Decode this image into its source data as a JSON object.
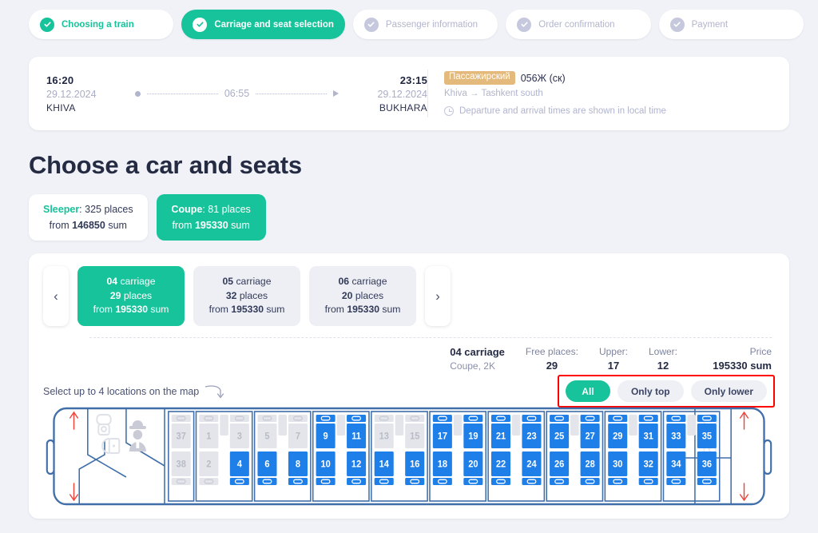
{
  "stepper": {
    "steps": [
      {
        "label": "Choosing a train",
        "state": "done"
      },
      {
        "label": "Carriage and seat selection",
        "state": "active"
      },
      {
        "label": "Passenger information",
        "state": "todo"
      },
      {
        "label": "Order confirmation",
        "state": "todo"
      },
      {
        "label": "Payment",
        "state": "todo"
      }
    ]
  },
  "train_card": {
    "departure": {
      "time": "16:20",
      "date": "29.12.2024",
      "city": "KHIVA"
    },
    "arrival": {
      "time": "23:15",
      "date": "29.12.2024",
      "city": "BUKHARA"
    },
    "duration": "06:55",
    "type_badge": "Пассажирский",
    "train_number": "056Ж (ск)",
    "full_route": "Khiva → Tashkent south",
    "local_time_note": "Departure and arrival times are shown in local time"
  },
  "page_title": "Choose a car and seats",
  "class_tabs": [
    {
      "name": "Sleeper",
      "places": "325 places",
      "from": "from",
      "price": "146850",
      "currency": "sum",
      "selected": false
    },
    {
      "name": "Coupe",
      "places": "81 places",
      "from": "from",
      "price": "195330",
      "currency": "sum",
      "selected": true
    }
  ],
  "carriages": {
    "prev_label": "‹",
    "next_label": "›",
    "items": [
      {
        "number": "04",
        "word": "carriage",
        "places": "29",
        "places_word": "places",
        "from": "from",
        "price": "195330",
        "currency": "sum",
        "selected": true
      },
      {
        "number": "05",
        "word": "carriage",
        "places": "32",
        "places_word": "places",
        "from": "from",
        "price": "195330",
        "currency": "sum",
        "selected": false
      },
      {
        "number": "06",
        "word": "carriage",
        "places": "20",
        "places_word": "places",
        "from": "from",
        "price": "195330",
        "currency": "sum",
        "selected": false
      }
    ]
  },
  "summary": {
    "carriage_name": "04 carriage",
    "carriage_type": "Coupe, 2K",
    "free_label": "Free places:",
    "free_value": "29",
    "upper_label": "Upper:",
    "upper_value": "17",
    "lower_label": "Lower:",
    "lower_value": "12",
    "price_label": "Price",
    "price_value": "195330 sum"
  },
  "filters": [
    {
      "label": "All",
      "selected": true
    },
    {
      "label": "Only top",
      "selected": false
    },
    {
      "label": "Only lower",
      "selected": false
    }
  ],
  "hint": "Select up to 4 locations on the map",
  "seatmap": {
    "compartments": [
      {
        "upper": [
          {
            "n": "37",
            "state": "occupied"
          }
        ],
        "lower": [
          {
            "n": "38",
            "state": "occupied"
          }
        ],
        "half": true
      },
      {
        "upper": [
          {
            "n": "1",
            "state": "occupied"
          },
          {
            "n": "3",
            "state": "occupied"
          }
        ],
        "lower": [
          {
            "n": "2",
            "state": "occupied"
          },
          {
            "n": "4",
            "state": "free"
          }
        ]
      },
      {
        "upper": [
          {
            "n": "5",
            "state": "occupied"
          },
          {
            "n": "7",
            "state": "occupied"
          }
        ],
        "lower": [
          {
            "n": "6",
            "state": "free"
          },
          {
            "n": "8",
            "state": "free"
          }
        ]
      },
      {
        "upper": [
          {
            "n": "9",
            "state": "free"
          },
          {
            "n": "11",
            "state": "free"
          }
        ],
        "lower": [
          {
            "n": "10",
            "state": "free"
          },
          {
            "n": "12",
            "state": "free"
          }
        ]
      },
      {
        "upper": [
          {
            "n": "13",
            "state": "occupied"
          },
          {
            "n": "15",
            "state": "occupied"
          }
        ],
        "lower": [
          {
            "n": "14",
            "state": "free"
          },
          {
            "n": "16",
            "state": "free"
          }
        ]
      },
      {
        "upper": [
          {
            "n": "17",
            "state": "free"
          },
          {
            "n": "19",
            "state": "free"
          }
        ],
        "lower": [
          {
            "n": "18",
            "state": "free"
          },
          {
            "n": "20",
            "state": "free"
          }
        ]
      },
      {
        "upper": [
          {
            "n": "21",
            "state": "free"
          },
          {
            "n": "23",
            "state": "free"
          }
        ],
        "lower": [
          {
            "n": "22",
            "state": "free"
          },
          {
            "n": "24",
            "state": "free"
          }
        ]
      },
      {
        "upper": [
          {
            "n": "25",
            "state": "free"
          },
          {
            "n": "27",
            "state": "free"
          }
        ],
        "lower": [
          {
            "n": "26",
            "state": "free"
          },
          {
            "n": "28",
            "state": "free"
          }
        ]
      },
      {
        "upper": [
          {
            "n": "29",
            "state": "free"
          },
          {
            "n": "31",
            "state": "free"
          }
        ],
        "lower": [
          {
            "n": "30",
            "state": "free"
          },
          {
            "n": "32",
            "state": "free"
          }
        ]
      },
      {
        "upper": [
          {
            "n": "33",
            "state": "free"
          },
          {
            "n": "35",
            "state": "free"
          }
        ],
        "lower": [
          {
            "n": "34",
            "state": "free"
          },
          {
            "n": "36",
            "state": "free"
          }
        ]
      }
    ],
    "icons": [
      "toilet-icon",
      "wardrobe-icon",
      "conductor-icon",
      "toilet-icon-right",
      "wardrobe-icon-right"
    ],
    "direction_arrows": [
      "up",
      "down",
      "up",
      "down"
    ]
  },
  "colors": {
    "accent_green": "#17c39a",
    "seat_free": "#1f7fe8",
    "seat_occupied": "#e3e5ea",
    "outline_blue": "#3f6ea8",
    "arrow_red": "#f2433a",
    "highlight_red": "#ff0000",
    "page_bg": "#f0f2f7"
  }
}
